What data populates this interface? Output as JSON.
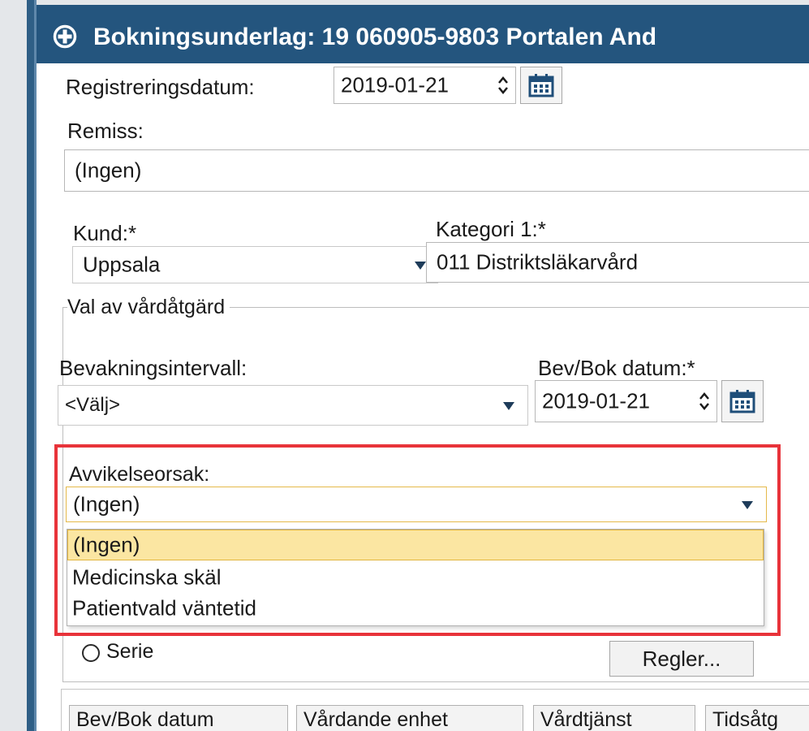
{
  "window": {
    "title": "Bokningsunderlag: 19 060905-9803 Portalen And"
  },
  "form": {
    "registreringsdatum_label": "Registreringsdatum:",
    "registreringsdatum_value": "2019-01-21",
    "remiss_label": "Remiss:",
    "remiss_value": "(Ingen)",
    "kund_label": "Kund:*",
    "kund_value": "Uppsala",
    "kategori_label": "Kategori 1:*",
    "kategori_value": "011 Distriktsläkarvård"
  },
  "val_av_vardatgard": {
    "group_title": "Val av vårdåtgärd",
    "bevakningsintervall_label": "Bevakningsintervall:",
    "bevakningsintervall_value": "<Välj>",
    "bevbok_label": "Bev/Bok datum:*",
    "bevbok_value": "2019-01-21",
    "avvikelseorsak_label": "Avvikelseorsak:",
    "avvikelseorsak_value": "(Ingen)",
    "avvikelseorsak_options": [
      "(Ingen)",
      "Medicinska skäl",
      "Patientvald väntetid"
    ],
    "selected_option_index": 0,
    "serie_label": "Serie",
    "regler_button": "Regler..."
  },
  "table": {
    "columns": [
      "Bev/Bok datum",
      "Vårdande enhet",
      "Vårdtjänst",
      "Tidsåtg"
    ]
  },
  "colors": {
    "titlebar": "#24557e",
    "highlight": "#e8333a",
    "selected_option": "#fbe6a2",
    "calendar_icon": "#1f4e79"
  }
}
